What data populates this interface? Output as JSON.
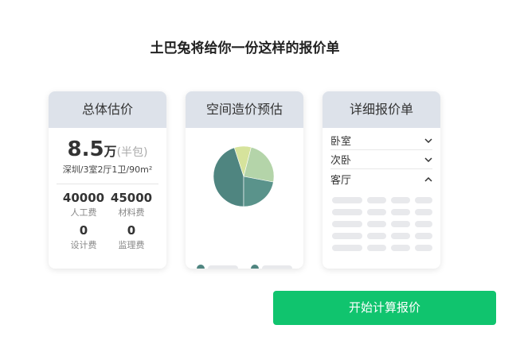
{
  "headline": "土巴兔将给你一份这样的报价单",
  "cards": {
    "total": {
      "title": "总体估价",
      "price_value": "8.5",
      "price_unit": "万",
      "price_mode": "(半包)",
      "house_info": "深圳/3室2厅1卫/90m²",
      "costs": [
        {
          "value": "40000",
          "label": "人工费"
        },
        {
          "value": "45000",
          "label": "材料费"
        },
        {
          "value": "0",
          "label": "设计费"
        },
        {
          "value": "0",
          "label": "监理费"
        }
      ]
    },
    "breakdown": {
      "title": "空间造价预估",
      "pie_colors": [
        "#4f8580",
        "#d6e39c",
        "#b4d4a9",
        "#5a938b"
      ],
      "pie_shares": [
        0.45,
        0.09,
        0.24,
        0.22
      ]
    },
    "detail": {
      "title": "详细报价单",
      "rooms": [
        {
          "label": "卧室",
          "chevron": "chevron-down"
        },
        {
          "label": "次卧",
          "chevron": "chevron-down"
        },
        {
          "label": "客厅",
          "chevron": "chevron-up"
        }
      ]
    }
  },
  "cta": {
    "label": "开始计算报价"
  }
}
